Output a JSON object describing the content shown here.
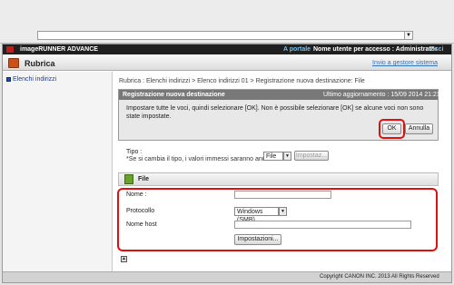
{
  "header": {
    "brand": "imageRUNNER ADVANCE",
    "portal_link": "A portale",
    "user_info": "Nome utente per accesso : Administrator",
    "logout": "Esci"
  },
  "subheader": {
    "title": "Rubrica",
    "goto_settings": "Invio a gestore sistema"
  },
  "sidebar": {
    "items": [
      {
        "label": "Elenchi indirizzi"
      }
    ]
  },
  "breadcrumb": "Rubrica : Elenchi indirizzi > Elenco indirizzi 01 > Registrazione nuova destinazione: File",
  "panel": {
    "title": "Registrazione nuova destinazione",
    "last_update": "Ultimo aggiornamento : 15/09 2014 21:21:02",
    "instruction": "Impostare tutte le voci, quindi selezionare [OK]. Non è possibile selezionare [OK] se alcune voci non sono state impostate.",
    "ok_label": "OK",
    "cancel_label": "Annulla"
  },
  "tipo": {
    "label": "Tipo :",
    "note": "*Se si cambia il tipo, i valori immessi saranno annullati.",
    "selected": "File",
    "settings_label": "Impostaz..."
  },
  "file_section": {
    "title": "File",
    "fields": {
      "nome_label": "Nome :",
      "nome_value": "",
      "protocollo_label": "Protocollo",
      "protocollo_value": "Windows (SMB)",
      "host_label": "Nome host",
      "host_value": "",
      "impostazioni_label": "Impostazioni..."
    }
  },
  "footer": {
    "copyright": "Copyright CANON INC. 2013 All Rights Reserved"
  },
  "colors": {
    "highlight": "#e01010",
    "link": "#3373b6",
    "header_bg": "#202020"
  }
}
